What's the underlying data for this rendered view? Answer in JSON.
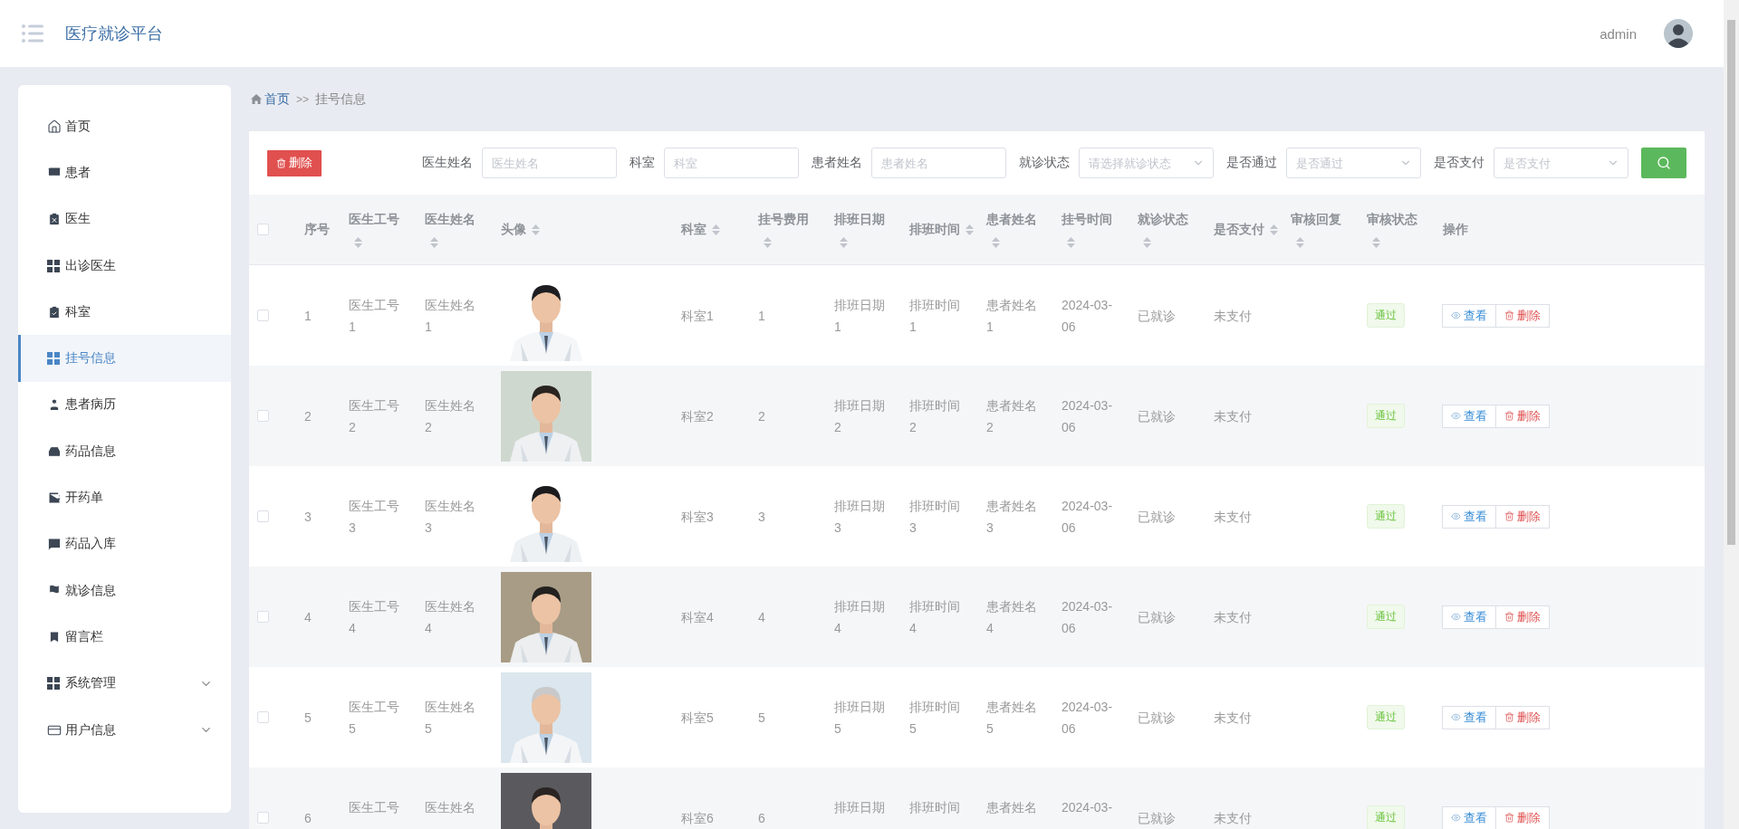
{
  "header": {
    "title": "医疗就诊平台",
    "user": "admin"
  },
  "sidebar": {
    "items": [
      {
        "label": "首页",
        "selected": false
      },
      {
        "label": "患者",
        "selected": false
      },
      {
        "label": "医生",
        "selected": false
      },
      {
        "label": "出诊医生",
        "selected": false
      },
      {
        "label": "科室",
        "selected": false
      },
      {
        "label": "挂号信息",
        "selected": true
      },
      {
        "label": "患者病历",
        "selected": false
      },
      {
        "label": "药品信息",
        "selected": false
      },
      {
        "label": "开药单",
        "selected": false
      },
      {
        "label": "药品入库",
        "selected": false
      },
      {
        "label": "就诊信息",
        "selected": false
      },
      {
        "label": "留言栏",
        "selected": false
      },
      {
        "label": "系统管理",
        "selected": false,
        "expanded": false
      },
      {
        "label": "用户信息",
        "selected": false,
        "expanded": false
      }
    ]
  },
  "breadcrumb": {
    "home": "首页",
    "separator": ">>",
    "current": "挂号信息"
  },
  "toolbar": {
    "delete_button": "删除",
    "filters": [
      {
        "kind": "input",
        "label": "医生姓名",
        "placeholder": "医生姓名"
      },
      {
        "kind": "input",
        "label": "科室",
        "placeholder": "科室"
      },
      {
        "kind": "input",
        "label": "患者姓名",
        "placeholder": "患者姓名"
      },
      {
        "kind": "select",
        "label": "就诊状态",
        "placeholder": "请选择就诊状态"
      },
      {
        "kind": "select",
        "label": "是否通过",
        "placeholder": "是否通过"
      },
      {
        "kind": "select",
        "label": "是否支付",
        "placeholder": "是否支付"
      }
    ]
  },
  "table": {
    "header_checked": false,
    "columns": [
      {
        "label": "序号"
      },
      {
        "label": "医生工号",
        "sortable": true
      },
      {
        "label": "医生姓名",
        "sortable": true
      },
      {
        "label": "头像",
        "sortable": true
      },
      {
        "label": "科室",
        "sortable": true
      },
      {
        "label": "挂号费用",
        "sortable": true
      },
      {
        "label": "排班日期",
        "sortable": true
      },
      {
        "label": "排班时间",
        "sortable": true
      },
      {
        "label": "患者姓名",
        "sortable": true
      },
      {
        "label": "挂号时间",
        "sortable": true
      },
      {
        "label": "就诊状态",
        "sortable": true
      },
      {
        "label": "是否支付",
        "sortable": true
      },
      {
        "label": "审核回复",
        "sortable": true
      },
      {
        "label": "审核状态",
        "sortable": true
      },
      {
        "label": "操作"
      }
    ],
    "rows": [
      {
        "checked": false,
        "no": "1",
        "doctor_no": "医生工号1",
        "doctor_name": "医生姓名1",
        "department": "科室1",
        "fee": "1",
        "schedule_date": "排班日期1",
        "schedule_time": "排班时间1",
        "patient_name": "患者姓名1",
        "registered_at": "2024-03-06",
        "visit_status": "已就诊",
        "payment": "未支付",
        "review_status": "通过",
        "actions": [
          "查看",
          "删除"
        ]
      },
      {
        "checked": false,
        "no": "2",
        "doctor_no": "医生工号2",
        "doctor_name": "医生姓名2",
        "department": "科室2",
        "fee": "2",
        "schedule_date": "排班日期2",
        "schedule_time": "排班时间2",
        "patient_name": "患者姓名2",
        "registered_at": "2024-03-06",
        "visit_status": "已就诊",
        "payment": "未支付",
        "review_status": "通过",
        "actions": [
          "查看",
          "删除"
        ]
      },
      {
        "checked": false,
        "no": "3",
        "doctor_no": "医生工号3",
        "doctor_name": "医生姓名3",
        "department": "科室3",
        "fee": "3",
        "schedule_date": "排班日期3",
        "schedule_time": "排班时间3",
        "patient_name": "患者姓名3",
        "registered_at": "2024-03-06",
        "visit_status": "已就诊",
        "payment": "未支付",
        "review_status": "通过",
        "actions": [
          "查看",
          "删除"
        ]
      },
      {
        "checked": false,
        "no": "4",
        "doctor_no": "医生工号4",
        "doctor_name": "医生姓名4",
        "department": "科室4",
        "fee": "4",
        "schedule_date": "排班日期4",
        "schedule_time": "排班时间4",
        "patient_name": "患者姓名4",
        "registered_at": "2024-03-06",
        "visit_status": "已就诊",
        "payment": "未支付",
        "review_status": "通过",
        "actions": [
          "查看",
          "删除"
        ]
      },
      {
        "checked": false,
        "no": "5",
        "doctor_no": "医生工号5",
        "doctor_name": "医生姓名5",
        "department": "科室5",
        "fee": "5",
        "schedule_date": "排班日期5",
        "schedule_time": "排班时间5",
        "patient_name": "患者姓名5",
        "registered_at": "2024-03-06",
        "visit_status": "已就诊",
        "payment": "未支付",
        "review_status": "通过",
        "actions": [
          "查看",
          "删除"
        ]
      },
      {
        "checked": false,
        "no": "6",
        "doctor_no": "医生工号",
        "doctor_name": "医生姓名",
        "department": "科室6",
        "fee": "6",
        "schedule_date": "排班日期",
        "schedule_time": "排班时间",
        "patient_name": "患者姓名",
        "registered_at": "2024-03-",
        "visit_status": "已就诊",
        "payment": "未支付",
        "review_status": "通过",
        "actions": [
          "查看",
          "删除"
        ]
      }
    ]
  }
}
